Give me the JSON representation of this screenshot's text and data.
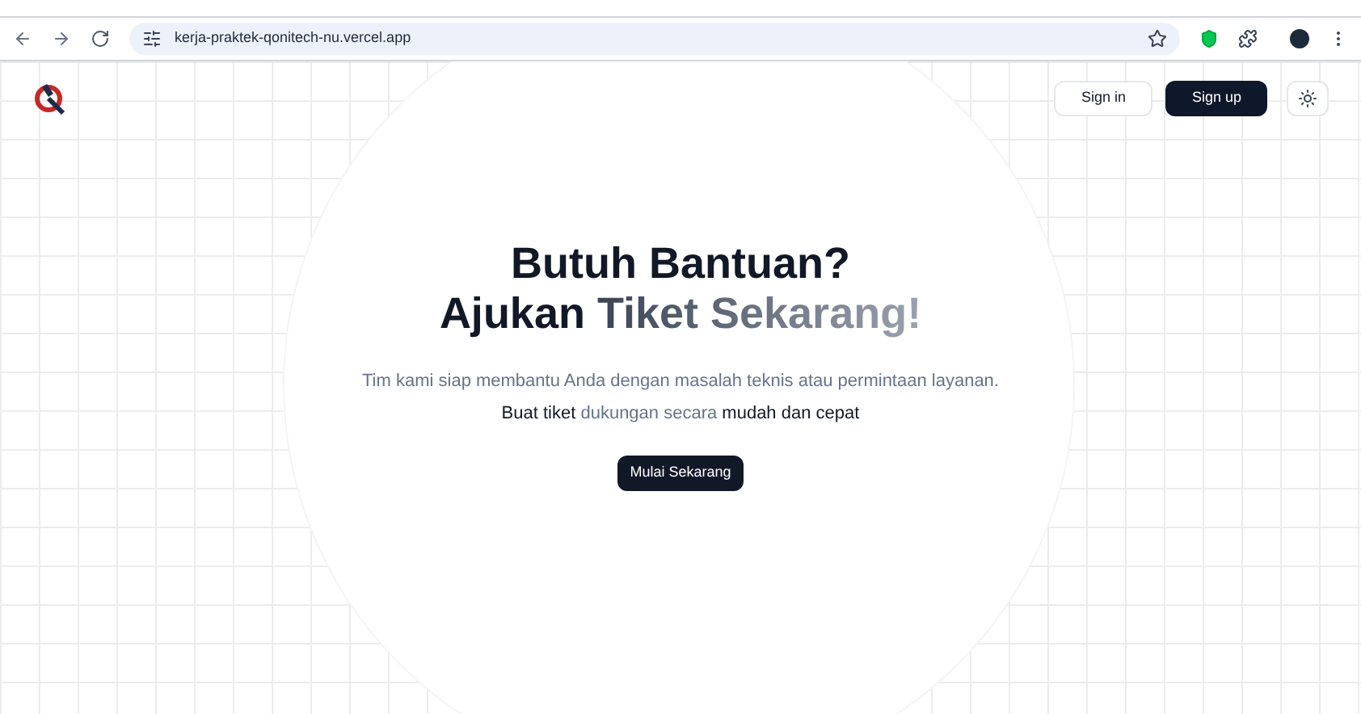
{
  "browser": {
    "url": "kerja-praktek-qonitech-nu.vercel.app"
  },
  "header": {
    "buttons": [
      {
        "label": "Sign in",
        "kind": "outline"
      },
      {
        "label": "Sign up",
        "kind": "solid"
      }
    ]
  },
  "hero": {
    "title_line_1": "Butuh Bantuan?",
    "title_line_2": [
      {
        "text": "Ajukan",
        "gradient": false
      },
      {
        "text": "Tiket Sekarang!",
        "gradient": true
      }
    ],
    "subtitle": "Tim kami siap membantu Anda dengan masalah teknis atau permintaan layanan.",
    "tagline": [
      {
        "text": "Buat tiket",
        "emphasis": true
      },
      {
        "text": "dukungan secara",
        "emphasis": false
      },
      {
        "text": "mudah dan cepat",
        "emphasis": true
      }
    ],
    "cta": "Mulai Sekarang"
  }
}
